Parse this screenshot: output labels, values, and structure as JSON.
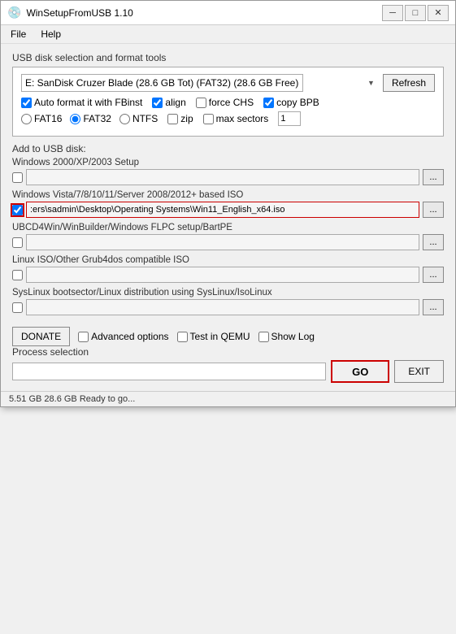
{
  "window": {
    "title": "WinSetupFromUSB 1.10",
    "icon": "💿"
  },
  "menu": {
    "items": [
      "File",
      "Help"
    ]
  },
  "usb_section": {
    "label": "USB disk selection and format tools",
    "drive_value": "E: SanDisk Cruzer Blade (28.6 GB Tot) (FAT32) (28.6 GB Free)",
    "refresh_label": "Refresh",
    "auto_format_label": "Auto format it with FBinst",
    "auto_format_checked": true,
    "align_label": "align",
    "align_checked": true,
    "force_chs_label": "force CHS",
    "force_chs_checked": false,
    "copy_bpb_label": "copy BPB",
    "copy_bpb_checked": true,
    "fat16_label": "FAT16",
    "fat32_label": "FAT32",
    "ntfs_label": "NTFS",
    "zip_label": "zip",
    "zip_checked": false,
    "max_sectors_label": "max sectors",
    "max_sectors_checked": false,
    "max_sectors_value": "1"
  },
  "add_usb": {
    "label": "Add to USB disk:",
    "categories": [
      {
        "id": "win2000",
        "label": "Windows 2000/XP/2003 Setup",
        "checked": false,
        "value": "",
        "highlighted": false
      },
      {
        "id": "winvista",
        "label": "Windows Vista/7/8/10/11/Server 2008/2012+ based ISO",
        "checked": true,
        "value": ":ers\\sadmin\\Desktop\\Operating Systems\\Win11_English_x64.iso",
        "highlighted": true
      },
      {
        "id": "ubcd",
        "label": "UBCD4Win/WinBuilder/Windows FLPC setup/BartPE",
        "checked": false,
        "value": "",
        "highlighted": false
      },
      {
        "id": "linux",
        "label": "Linux ISO/Other Grub4dos compatible ISO",
        "checked": false,
        "value": "",
        "highlighted": false
      },
      {
        "id": "syslinux",
        "label": "SysLinux bootsector/Linux distribution using SysLinux/IsoLinux",
        "checked": false,
        "value": "",
        "highlighted": false
      }
    ]
  },
  "bottom": {
    "donate_label": "DONATE",
    "advanced_options_label": "Advanced options",
    "advanced_options_checked": false,
    "test_qemu_label": "Test in QEMU",
    "test_qemu_checked": false,
    "show_log_label": "Show Log",
    "show_log_checked": false,
    "process_selection_label": "Process selection",
    "go_label": "GO",
    "exit_label": "EXIT"
  },
  "status_bar": {
    "text": "5.51 GB  28.6 GB  Ready to go..."
  }
}
